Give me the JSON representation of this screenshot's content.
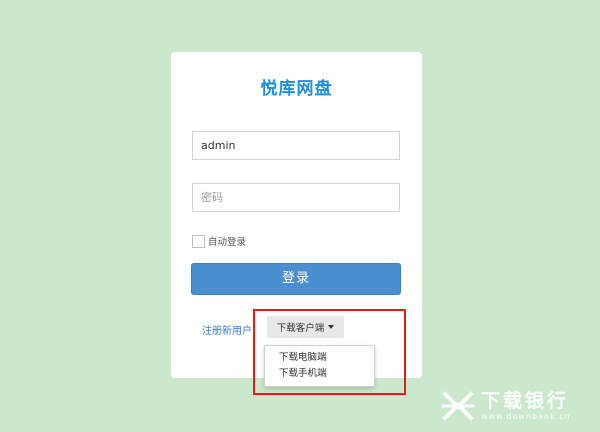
{
  "app": {
    "title": "悦库网盘"
  },
  "login_form": {
    "username": {
      "value": "admin",
      "placeholder": ""
    },
    "password": {
      "value": "",
      "placeholder": "密码"
    },
    "remember_label": "自动登录",
    "remember_checked": false,
    "submit_label": "登录"
  },
  "footer_links": {
    "register_label": "注册新用户",
    "download_client_label": "下载客户端"
  },
  "download_menu": {
    "items": [
      {
        "label": "下载电脑端"
      },
      {
        "label": "下载手机端"
      }
    ]
  },
  "watermark": {
    "name_cn": "下载银行",
    "domain": "www.downbank.cn"
  },
  "colors": {
    "page_background": "#cbe8cc",
    "title": "#1e8fe0",
    "primary_button": "#4a8fd0",
    "link": "#3a7cc4",
    "highlight_border": "#e41b1b"
  },
  "icons": {
    "dropdown_caret": "caret-down-icon",
    "watermark_logo": "downbank-logo-icon"
  }
}
